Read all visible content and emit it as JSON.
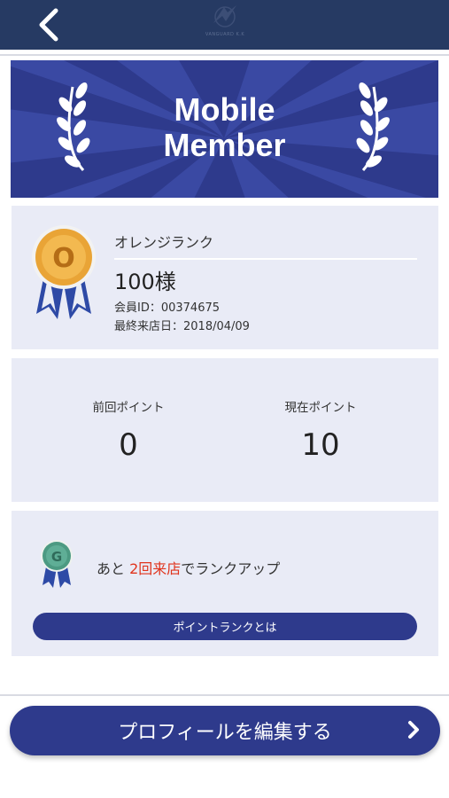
{
  "nav": {
    "back_icon": "chevron-left-icon",
    "logo_text": "VANGUARD K.K"
  },
  "banner": {
    "title_line1": "Mobile",
    "title_line2": "Member",
    "bg_color": "#2e3a8c"
  },
  "rank": {
    "medal_letter": "O",
    "name": "オレンジランク",
    "member_name": "100様",
    "member_id": "会員ID：00374675",
    "last_visit": "最終来店日：2018/04/09"
  },
  "points": {
    "previous_label": "前回ポイント",
    "previous_value": "0",
    "current_label": "現在ポイント",
    "current_value": "10"
  },
  "rankup": {
    "medal_letter": "G",
    "prefix": "あと ",
    "highlight": "2回来店",
    "suffix": "でランクアップ",
    "highlight_color": "#e0341d",
    "info_button_label": "ポイントランクとは"
  },
  "profile_button": {
    "label": "プロフィールを編集する",
    "icon": "chevron-right-icon"
  }
}
